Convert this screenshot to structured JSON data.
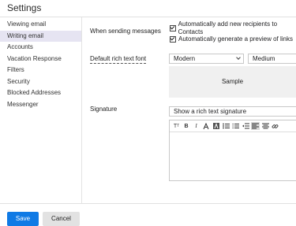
{
  "header": {
    "title": "Settings"
  },
  "sidebar": {
    "items": [
      {
        "label": "Viewing email"
      },
      {
        "label": "Writing email"
      },
      {
        "label": "Accounts"
      },
      {
        "label": "Vacation Response"
      },
      {
        "label": "Filters"
      },
      {
        "label": "Security"
      },
      {
        "label": "Blocked Addresses"
      },
      {
        "label": "Messenger"
      }
    ],
    "active": "Writing email"
  },
  "sending": {
    "label": "When sending messages",
    "option1": "Automatically add new recipients to Contacts",
    "option2": "Automatically generate a preview of links",
    "option1_checked": true,
    "option2_checked": true
  },
  "font": {
    "label": "Default rich text font",
    "family": "Modern",
    "size": "Medium",
    "sample": "Sample"
  },
  "signature": {
    "label": "Signature",
    "mode": "Show a rich text signature",
    "toolbar_icons": [
      "text-size-icon",
      "bold-icon",
      "italic-icon",
      "text-color-icon",
      "highlight-icon",
      "bullet-list-icon",
      "numbered-list-icon",
      "outdent-icon",
      "align-left-icon",
      "align-center-icon",
      "link-icon"
    ]
  },
  "footer": {
    "save_label": "Save",
    "cancel_label": "Cancel"
  },
  "colors": {
    "accent": "#0f7ae5",
    "active_nav": "#e6e4f2"
  }
}
